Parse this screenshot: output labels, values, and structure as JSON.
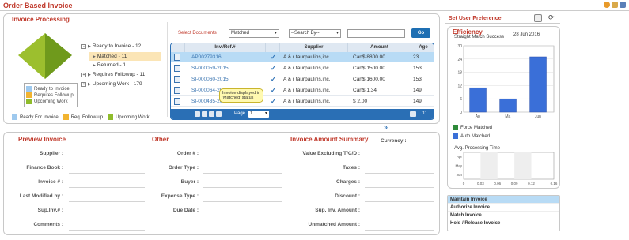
{
  "app": {
    "title": "Order Based Invoice"
  },
  "invoice_processing": {
    "title": "Invoice Processing",
    "legend": [
      "Ready to Invoice",
      "Requires Followup",
      "Upcoming Work"
    ],
    "bottom_legend": [
      "Ready For Invoice",
      "Req. Follow-up",
      "Upcoming Work"
    ],
    "tree": [
      {
        "label": "Ready to Invoice - 12"
      },
      {
        "label": "Matched - 11"
      },
      {
        "label": "Returned - 1"
      },
      {
        "label": "Requires Followup - 11"
      },
      {
        "label": "Upcoming Work - 179"
      }
    ],
    "select_documents_label": "Select Documents",
    "select_documents_value": "Matched",
    "search_by_value": "--Search By--",
    "search_input_value": "",
    "go_label": "Go",
    "table": {
      "headers": [
        "Inv./Ref.#",
        "Supplier",
        "Amount",
        "Age"
      ],
      "rows": [
        {
          "inv": "AP00279316",
          "supplier": "A & r taurpaulins,inc.",
          "amount": "Can$ 8800.00",
          "age": "23"
        },
        {
          "inv": "SI-000059-2015",
          "supplier": "A & r taurpaulins,inc.",
          "amount": "Can$ 1500.00",
          "age": "153"
        },
        {
          "inv": "SI-000060-2015",
          "supplier": "A & r taurpaulins,inc.",
          "amount": "Can$ 1600.00",
          "age": "153"
        },
        {
          "inv": "SI-000064-2015",
          "supplier": "A & r taurpaulins,inc.",
          "amount": "Can$ 1.34",
          "age": "149"
        },
        {
          "inv": "SI-000435-2015",
          "supplier": "A & r taurpaulins,inc.",
          "amount": "$ 2.00",
          "age": "149"
        }
      ],
      "page_label": "Page",
      "page_value": "1",
      "total_pages": "11"
    },
    "tooltip": "Invoice displayed in 'Matched' status"
  },
  "set_user_preference": {
    "title": "Set User Preference"
  },
  "efficiency": {
    "title": "Efficiency",
    "date": "28 Jun 2016",
    "chart1_title": "Straight Match Success",
    "chart2_title": "Avg. Processing Time",
    "legend": [
      "Force Matched",
      "Auto Matched"
    ],
    "colors": {
      "force": "#2e8b3a",
      "auto": "#3a6fd8"
    }
  },
  "chart_data": [
    {
      "type": "bar",
      "title": "Straight Match Success",
      "categories": [
        "Ap",
        "Ma",
        "Jun"
      ],
      "values": [
        11,
        6,
        25
      ],
      "ylim": [
        0,
        30
      ],
      "yticks": [
        "0",
        "6",
        "12",
        "18",
        "24",
        "30"
      ]
    },
    {
      "type": "bar",
      "title": "Avg. Processing Time",
      "categories": [
        "Apr",
        "May",
        "Jun"
      ],
      "values": [
        0,
        0,
        0
      ],
      "xlim": [
        0,
        0.16
      ],
      "xticks": [
        "0",
        "0.03",
        "0.06",
        "0.09",
        "0.12",
        "0.16"
      ]
    }
  ],
  "preview": {
    "title": "Preview Invoice",
    "fields": [
      "Supplier :",
      "Finance Book :",
      "Invoice # :",
      "Last Modified by :",
      "Sup.Inv.# :",
      "Comments :"
    ]
  },
  "other": {
    "title": "Other",
    "fields": [
      "Order # :",
      "Order Type :",
      "Buyer :",
      "Expense Type :",
      "Due Date :"
    ]
  },
  "summary": {
    "title": "Invoice Amount Summary",
    "currency_label": "Currency :",
    "fields": [
      "Value Excluding T/C/D :",
      "Taxes :",
      "Charges :",
      "Discount :",
      "Sup. Inv. Amount :",
      "Unmatched Amount :"
    ]
  },
  "actions_menu": [
    "Maintain Invoice",
    "Authorize Invoice",
    "Match Invoice",
    "Hold / Release Invoice"
  ]
}
